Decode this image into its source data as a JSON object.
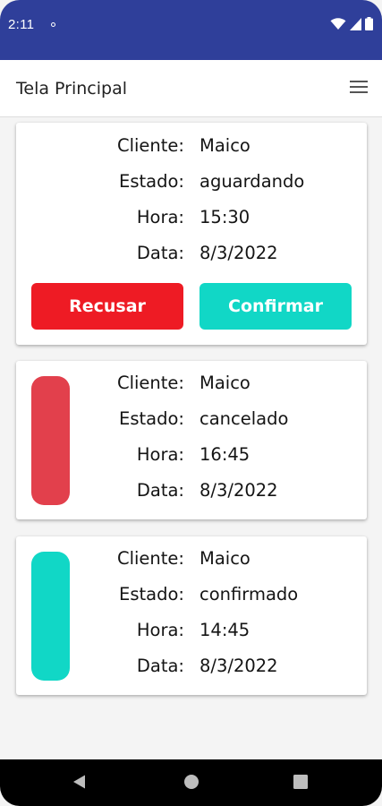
{
  "status_bar": {
    "time": "2:11",
    "background": "#2f3f9a",
    "icons": [
      "notification-dot-icon",
      "wifi-icon",
      "cellular-signal-icon",
      "battery-icon"
    ]
  },
  "app_bar": {
    "title": "Tela Principal",
    "menu_icon": "hamburger-menu-icon"
  },
  "labels": {
    "cliente": "Cliente:",
    "estado": "Estado:",
    "hora": "Hora:",
    "data": "Data:"
  },
  "cards": [
    {
      "cliente": "Maico",
      "estado": "aguardando",
      "hora": "15:30",
      "data": "8/3/2022",
      "actions": {
        "refuse_label": "Recusar",
        "confirm_label": "Confirmar"
      }
    },
    {
      "cliente": "Maico",
      "estado": "cancelado",
      "hora": "16:45",
      "data": "8/3/2022",
      "indicator_color": "#e2404c"
    },
    {
      "cliente": "Maico",
      "estado": "confirmado",
      "hora": "14:45",
      "data": "8/3/2022",
      "indicator_color": "#11d7c6"
    }
  ],
  "colors": {
    "refuse": "#ee1b24",
    "confirm": "#11d7c6",
    "cancelled": "#e2404c",
    "confirmed": "#11d7c6"
  },
  "nav_bar": {
    "icons": [
      "back-icon",
      "home-icon",
      "recents-icon"
    ]
  }
}
